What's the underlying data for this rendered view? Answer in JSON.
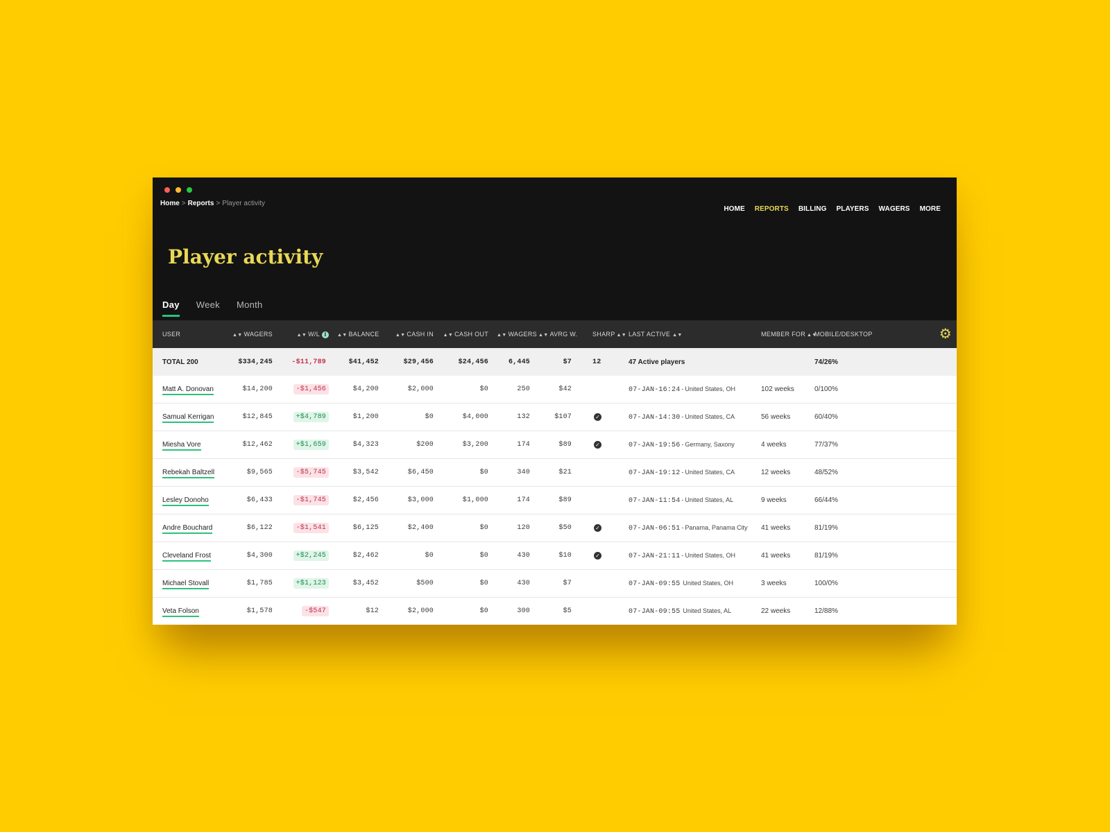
{
  "window": {
    "dots": [
      "#ff5f57",
      "#febc2e",
      "#28c840"
    ]
  },
  "breadcrumb": {
    "items": [
      {
        "label": "Home"
      },
      {
        "label": "Reports"
      },
      {
        "label": "Player activity"
      }
    ],
    "separator": ">"
  },
  "nav": {
    "items": [
      "HOME",
      "REPORTS",
      "BILLING",
      "PLAYERS",
      "WAGERS",
      "MORE"
    ],
    "active": "REPORTS"
  },
  "page_title": "Player activity",
  "tabs": [
    "Day",
    "Week",
    "Month"
  ],
  "active_tab": "Day",
  "table": {
    "columns": {
      "user": "USER",
      "wagers": "WAGERS",
      "wl": "W/L",
      "balance": "BALANCE",
      "cash_in": "CASH IN",
      "cash_out": "CASH OUT",
      "wagers_count": "WAGERS",
      "avrg": "AVRG W.",
      "sharp": "SHARP",
      "last_active": "LAST ACTIVE",
      "member_for": "MEMBER FOR",
      "mobile_desktop": "MOBILE/DESKTOP"
    },
    "settings_icon": "gear-icon",
    "total": {
      "user": "TOTAL 200",
      "wagers": "$334,245",
      "wl": "-$11,789",
      "balance": "$41,452",
      "cash_in": "$29,456",
      "cash_out": "$24,456",
      "wagers_count": "6,445",
      "avrg": "$7",
      "sharp": "12",
      "last_active": "47 Active players",
      "member_for": "",
      "mobile_desktop": "74/26%"
    },
    "rows": [
      {
        "user": "Matt A. Donovan",
        "wagers": "$14,200",
        "wl": "-$1,456",
        "wl_sign": "neg",
        "balance": "$4,200",
        "cash_in": "$2,000",
        "cash_out": "$0",
        "wagers_count": "250",
        "avrg": "$42",
        "sharp": false,
        "time": "07-JAN-16:24",
        "sep": "-",
        "location": "United States, OH",
        "member_for": "102 weeks",
        "mobile_desktop": "0/100%"
      },
      {
        "user": "Samual Kerrigan",
        "wagers": "$12,845",
        "wl": "+$4,789",
        "wl_sign": "pos",
        "balance": "$1,200",
        "cash_in": "$0",
        "cash_out": "$4,000",
        "wagers_count": "132",
        "avrg": "$107",
        "sharp": true,
        "time": "07-JAN-14:30",
        "sep": "-",
        "location": "United States, CA",
        "member_for": "56 weeks",
        "mobile_desktop": "60/40%"
      },
      {
        "user": "Miesha Vore",
        "wagers": "$12,462",
        "wl": "+$1,659",
        "wl_sign": "pos",
        "balance": "$4,323",
        "cash_in": "$200",
        "cash_out": "$3,200",
        "wagers_count": "174",
        "avrg": "$89",
        "sharp": true,
        "time": "07-JAN-19:56",
        "sep": "-",
        "location": "Germany, Saxony",
        "member_for": "4 weeks",
        "mobile_desktop": "77/37%"
      },
      {
        "user": "Rebekah Baltzell",
        "wagers": "$9,565",
        "wl": "-$5,745",
        "wl_sign": "neg",
        "balance": "$3,542",
        "cash_in": "$6,450",
        "cash_out": "$0",
        "wagers_count": "340",
        "avrg": "$21",
        "sharp": false,
        "time": "07-JAN-19:12",
        "sep": "-",
        "location": "United States, CA",
        "member_for": "12 weeks",
        "mobile_desktop": "48/52%"
      },
      {
        "user": "Lesley Donoho",
        "wagers": "$6,433",
        "wl": "-$1,745",
        "wl_sign": "neg",
        "balance": "$2,456",
        "cash_in": "$3,000",
        "cash_out": "$1,000",
        "wagers_count": "174",
        "avrg": "$89",
        "sharp": false,
        "time": "07-JAN-11:54",
        "sep": "-",
        "location": "United States, AL",
        "member_for": "9 weeks",
        "mobile_desktop": "66/44%"
      },
      {
        "user": "Andre Bouchard",
        "wagers": "$6,122",
        "wl": "-$1,541",
        "wl_sign": "neg",
        "balance": "$6,125",
        "cash_in": "$2,400",
        "cash_out": "$0",
        "wagers_count": "120",
        "avrg": "$50",
        "sharp": true,
        "time": "07-JAN-06:51",
        "sep": "-",
        "location": "Panama, Panama City",
        "member_for": "41 weeks",
        "mobile_desktop": "81/19%"
      },
      {
        "user": "Cleveland Frost",
        "wagers": "$4,300",
        "wl": "+$2,245",
        "wl_sign": "pos",
        "balance": "$2,462",
        "cash_in": "$0",
        "cash_out": "$0",
        "wagers_count": "430",
        "avrg": "$10",
        "sharp": true,
        "time": "07-JAN-21:11",
        "sep": "-",
        "location": "United States, OH",
        "member_for": "41 weeks",
        "mobile_desktop": "81/19%"
      },
      {
        "user": "Michael Stovall",
        "wagers": "$1,785",
        "wl": "+$1,123",
        "wl_sign": "pos",
        "balance": "$3,452",
        "cash_in": "$500",
        "cash_out": "$0",
        "wagers_count": "430",
        "avrg": "$7",
        "sharp": false,
        "time": "07-JAN-09:55",
        "sep": "",
        "location": "United States, OH",
        "member_for": "3 weeks",
        "mobile_desktop": "100/0%"
      },
      {
        "user": "Veta Folson",
        "wagers": "$1,578",
        "wl": "-$547",
        "wl_sign": "neg",
        "balance": "$12",
        "cash_in": "$2,000",
        "cash_out": "$0",
        "wagers_count": "300",
        "avrg": "$5",
        "sharp": false,
        "time": "07-JAN-09:55",
        "sep": "",
        "location": "United States, AL",
        "member_for": "22 weeks",
        "mobile_desktop": "12/88%"
      }
    ]
  }
}
